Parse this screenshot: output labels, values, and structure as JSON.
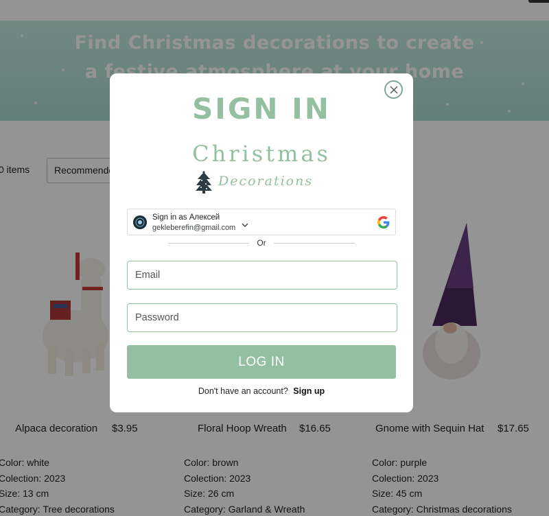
{
  "hero": {
    "title_line1": "Find Christmas decorations to create",
    "title_line2": "a festive atmosphere at your home"
  },
  "toolbar": {
    "item_count": "0 items",
    "sort_value": "Recommended"
  },
  "products": [
    {
      "name": "Alpaca decoration",
      "price": "$3.95",
      "color": "Color: white",
      "collection": "Colection: 2023",
      "size": "Size: 13 cm",
      "category": "Category: Tree decorations"
    },
    {
      "name": "Floral Hoop Wreath",
      "price": "$16.65",
      "color": "Color: brown",
      "collection": "Colection: 2023",
      "size": "Size: 26 cm",
      "category": "Category: Garland & Wreath"
    },
    {
      "name": "Gnome with Sequin Hat",
      "price": "$17.65",
      "color": "Color: purple",
      "collection": "Colection: 2023",
      "size": "Size: 45 cm",
      "category": "Category: Christmas decorations"
    }
  ],
  "modal": {
    "title": "SIGN IN",
    "logo_word1": "Christmas",
    "logo_word2": "Decorations",
    "google": {
      "sign_in_label": "Sign in as Алексей",
      "email": "gekleberefin@gmail.com"
    },
    "divider_text": "Or",
    "email_placeholder": "Email",
    "password_placeholder": "Password",
    "login_label": "LOG IN",
    "signup_prompt": "Don't have an account?",
    "signup_link": "Sign up"
  },
  "colors": {
    "accent": "#93c0a0",
    "hero_bg": "#b5e2d6"
  },
  "icons": [
    "close-icon",
    "tree-icon",
    "google-icon",
    "chevron-down-icon"
  ]
}
